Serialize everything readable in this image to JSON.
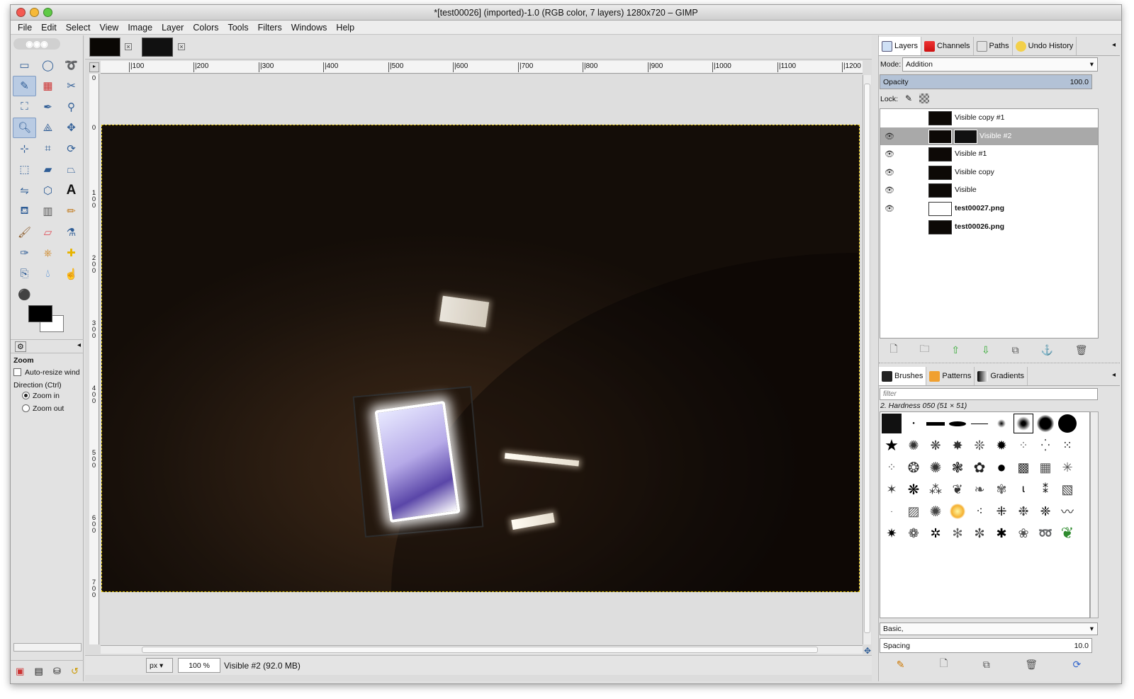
{
  "window": {
    "title": "*[test00026] (imported)-1.0 (RGB color, 7 layers) 1280x720 – GIMP"
  },
  "menu": [
    "File",
    "Edit",
    "Select",
    "View",
    "Image",
    "Layer",
    "Colors",
    "Tools",
    "Filters",
    "Windows",
    "Help"
  ],
  "toolbox": {
    "tool_icons": [
      "rect-select-icon",
      "ellipse-select-icon",
      "lasso-icon",
      "fuzzy-select-icon",
      "select-by-color-icon",
      "scissors-icon",
      "foreground-select-icon",
      "paths-icon",
      "color-picker-icon",
      "zoom-icon",
      "measure-icon",
      "move-icon",
      "align-icon",
      "crop-icon",
      "rotate-icon",
      "scale-icon",
      "shear-icon",
      "perspective-icon",
      "flip-icon",
      "cage-icon",
      "text-icon",
      "bucket-fill-icon",
      "blend-icon",
      "pencil-icon",
      "paintbrush-icon",
      "eraser-icon",
      "airbrush-icon",
      "ink-icon",
      "clone-icon",
      "heal-icon",
      "perspective-clone-icon",
      "blur-icon",
      "smudge-icon",
      "dodge-burn-icon"
    ],
    "options_title": "Zoom",
    "auto_resize": "Auto-resize wind",
    "direction_label": "Direction  (Ctrl)",
    "zoom_in": "Zoom in",
    "zoom_out": "Zoom out"
  },
  "canvas": {
    "ruler_h": [
      "|100",
      "|200",
      "|300",
      "|400",
      "|500",
      "|600",
      "|700",
      "|800",
      "|900",
      "|1000",
      "|1100",
      "|1200"
    ],
    "ruler_v": [
      "0",
      "0",
      "100",
      "200",
      "300",
      "400",
      "500",
      "600",
      "700"
    ]
  },
  "status": {
    "unit": "px",
    "zoom": "100 %",
    "layer_info": "Visible #2 (92.0 MB)"
  },
  "layers": {
    "tabs": [
      "Layers",
      "Channels",
      "Paths",
      "Undo History"
    ],
    "mode_label": "Mode:",
    "mode_value": "Addition",
    "opacity_label": "Opacity",
    "opacity_value": "100.0",
    "lock_label": "Lock:",
    "items": [
      {
        "name": "Visible copy #1",
        "visible": false,
        "selected": false
      },
      {
        "name": "Visible #2",
        "visible": true,
        "selected": true
      },
      {
        "name": "Visible #1",
        "visible": true,
        "selected": false
      },
      {
        "name": "Visible copy",
        "visible": true,
        "selected": false
      },
      {
        "name": "Visible",
        "visible": true,
        "selected": false
      },
      {
        "name": "test00027.png",
        "visible": true,
        "selected": false
      },
      {
        "name": "test00026.png",
        "visible": false,
        "selected": false
      }
    ]
  },
  "brushes": {
    "tabs": [
      "Brushes",
      "Patterns",
      "Gradients"
    ],
    "filter_placeholder": "filter",
    "current": "2. Hardness 050 (51 × 51)",
    "preset": "Basic,",
    "spacing_label": "Spacing",
    "spacing_value": "10.0"
  },
  "colors": {
    "fg": "#000000",
    "bg": "#ffffff",
    "selection": "#a9a9a9"
  }
}
